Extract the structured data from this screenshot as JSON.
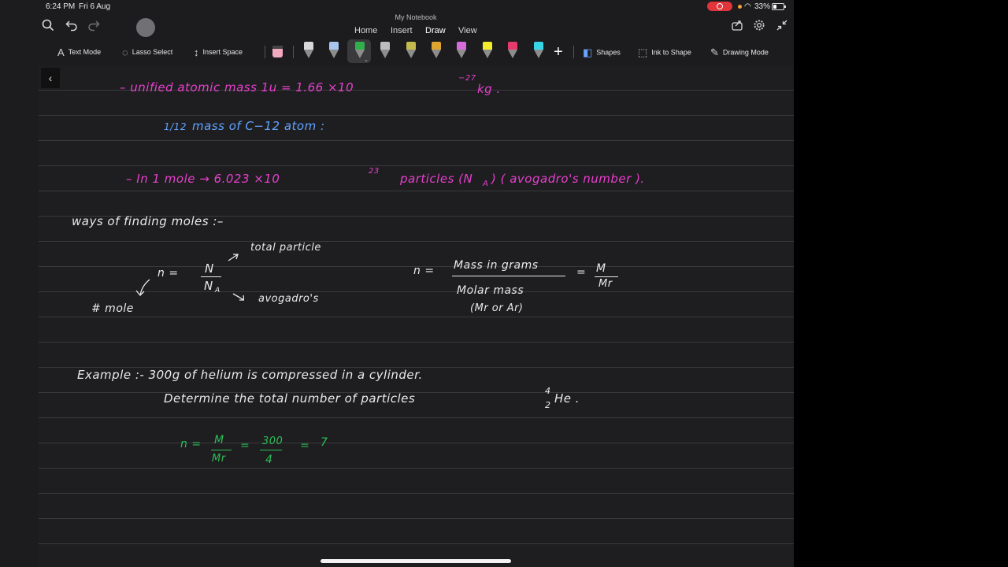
{
  "status": {
    "time": "6:24 PM",
    "date": "Fri 6 Aug",
    "battery": "33%"
  },
  "app": {
    "title": "My Notebook"
  },
  "tabs": [
    {
      "label": "Home"
    },
    {
      "label": "Insert"
    },
    {
      "label": "Draw",
      "active": true
    },
    {
      "label": "View"
    }
  ],
  "ribbon": {
    "text_mode": "Text Mode",
    "lasso_select": "Lasso Select",
    "insert_space": "Insert Space",
    "shapes": "Shapes",
    "ink_to_shape": "Ink to Shape",
    "drawing_mode": "Drawing Mode",
    "pens": [
      {
        "color": "#d9d9d9"
      },
      {
        "color": "#a9c6ef"
      },
      {
        "color": "#2fb04a"
      },
      {
        "color": "#bdbdbd"
      },
      {
        "color": "#c3b94c"
      },
      {
        "color": "#e0a52f"
      },
      {
        "color": "#d66bd9"
      },
      {
        "color": "#f3ee2a"
      },
      {
        "color": "#e53a6b"
      },
      {
        "color": "#37d6e6"
      }
    ]
  },
  "notes": {
    "line1": "– unified   atomic   mass     1u  =   1.66 ×10",
    "line1_exp": "−27",
    "line1_unit": "kg .",
    "line2": "mass  of   C−12    atom  :",
    "line2_frac": "1/12",
    "line3": "–  In     1  mole   →    6.023 ×10",
    "line3_exp": "23",
    "line3_rest": "particles (N",
    "line3_sub": "A",
    "line3_end": ")   ( avogadro's  number ).",
    "ways": "ways   of   finding  moles :–",
    "n_eq": "n  =",
    "N": "N",
    "NA": "N",
    "NA_sub": "A",
    "total_particle": "total  particle",
    "avogadros": "avogadro's",
    "hash_mole": "#   mole",
    "n_eq2": "n  =",
    "mass_in_grams": "Mass  in  grams",
    "molar_mass": "Molar  mass",
    "mr_or_ar": "(Mr  or Ar)",
    "eq_M": "=",
    "M": "M",
    "Mr": "Mr",
    "example1": "Example :-   300g   of   helium   is    compressed    in    a   cylinder.",
    "example2": "Determine    the    total    number     of     particles",
    "he_top": "4",
    "he_bot": "2",
    "he": "He .",
    "calc_n": "n =",
    "calc_M": "M",
    "calc_Mr": "Mr",
    "calc_eq1": "=",
    "calc_300": "300",
    "calc_4": "4",
    "calc_eq2": "=",
    "calc_ans": "7"
  }
}
